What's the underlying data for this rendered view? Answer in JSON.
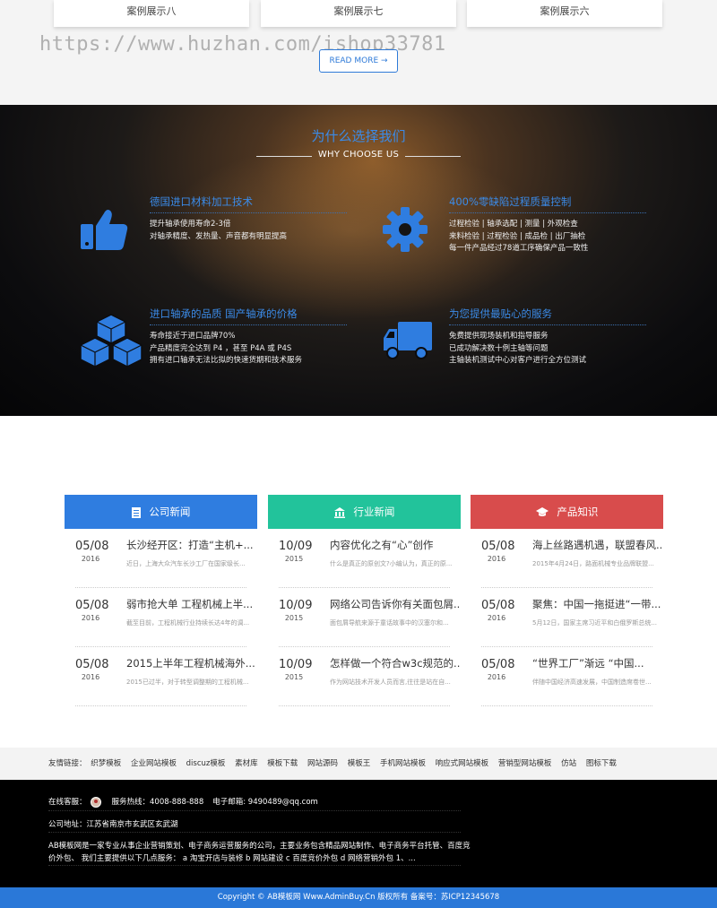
{
  "cases": {
    "items": [
      "案例展示八",
      "案例展示七",
      "案例展示六"
    ],
    "watermark": "https://www.huzhan.com/ishop33781",
    "read_more": "READ MORE →"
  },
  "why": {
    "title": "为什么选择我们",
    "subtitle": "WHY CHOOSE US",
    "features": [
      {
        "icon": "thumbs-up-icon",
        "title": "德国进口材料加工技术",
        "lines": [
          "提升轴承使用寿命2-3倍",
          "对轴承精度、发热量、声音都有明显提高"
        ]
      },
      {
        "icon": "gear-icon",
        "title": "400%零缺陷过程质量控制",
        "lines": [
          "过程检验 | 轴承选配 | 测量 | 外观检查",
          "来料检验 | 过程检验 | 成品检 | 出厂抽检",
          "每一件产品经过78道工序确保产品一致性"
        ]
      },
      {
        "icon": "cubes-icon",
        "title": "进口轴承的品质 国产轴承的价格",
        "lines": [
          "寿命接近于进口品牌70%",
          "产品精度完全达到 P4 ，甚至 P4A 或 P4S",
          "拥有进口轴承无法比拟的快速货期和技术服务"
        ]
      },
      {
        "icon": "truck-icon",
        "title": "为您提供最贴心的服务",
        "lines": [
          "免费提供现场装机和指导服务",
          "已成功解决数十例主轴等问题",
          "主轴装机测试中心对客户进行全方位测试"
        ]
      }
    ]
  },
  "news": {
    "columns": [
      {
        "title": "公司新闻",
        "icon": "document-icon",
        "color": "#2f7de0",
        "items": [
          {
            "md": "05/08",
            "yr": "2016",
            "title": "长沙经开区：打造“主机+...",
            "summary": "近日，上海大众汽车长沙工厂在国家级长..."
          },
          {
            "md": "05/08",
            "yr": "2016",
            "title": "弱市抢大单 工程机械上半...",
            "summary": "截至目前，工程机械行业持续长达4年的调..."
          },
          {
            "md": "05/08",
            "yr": "2016",
            "title": "2015上半年工程机械海外...",
            "summary": "2015已过半，对于转型调整期的工程机械..."
          }
        ]
      },
      {
        "title": "行业新闻",
        "icon": "bank-icon",
        "color": "#22c39b",
        "items": [
          {
            "md": "10/09",
            "yr": "2015",
            "title": "内容优化之有“心”创作",
            "summary": "什么是真正的原创文?小编认为，真正的原..."
          },
          {
            "md": "10/09",
            "yr": "2015",
            "title": "网络公司告诉你有关面包屑...",
            "summary": "面包屑导航来源于童话故事中的汉塞尔和..."
          },
          {
            "md": "10/09",
            "yr": "2015",
            "title": "怎样做一个符合w3c规范的...",
            "summary": "作为网站技术开发人员而言,往往是站在自..."
          }
        ]
      },
      {
        "title": "产品知识",
        "icon": "graduation-cap-icon",
        "color": "#d84c4c",
        "items": [
          {
            "md": "05/08",
            "yr": "2016",
            "title": "海上丝路遇机遇，联盟春风...",
            "summary": "2015年4月24日，路面机械专业品牌联盟..."
          },
          {
            "md": "05/08",
            "yr": "2016",
            "title": "聚焦：中国一拖挺进“一带...",
            "summary": "5月12日，国家主席习近平和白俄罗斯总统..."
          },
          {
            "md": "05/08",
            "yr": "2016",
            "title": "“世界工厂”渐远 “中国...",
            "summary": "伴随中国经济高速发展，中国制造席卷世..."
          }
        ]
      }
    ]
  },
  "links": {
    "label": "友情链接：",
    "items": [
      "织梦模板",
      "企业网站模板",
      "discuz模板",
      "素材库",
      "模板下载",
      "网站源码",
      "模板王",
      "手机网站模板",
      "响应式网站模板",
      "营销型网站模板",
      "仿站",
      "图标下载"
    ]
  },
  "footer": {
    "online_label": "在线客服：",
    "hotline": "服务热线：4008-888-888",
    "email": "电子邮箱: 9490489@qq.com",
    "address": "公司地址：江苏省南京市玄武区玄武湖",
    "intro_1": "AB模板网是一家专业从事企业营销策划、电子商务运营服务的公司，主要业务包含精品网站制作、电子商务平台托管、百度竞",
    "intro_2": "价外包、 我们主要提供以下几点服务： a 淘宝开店与装修 b 网站建设 c 百度竞价外包 d 网络营销外包 1、...",
    "copyright": "Copyright © AB模板网 Www.AdminBuy.Cn 版权所有  备案号：苏ICP12345678"
  }
}
